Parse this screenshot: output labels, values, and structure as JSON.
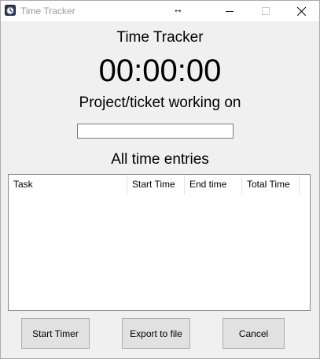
{
  "window": {
    "title": "Time Tracker",
    "icons": {
      "app": "stopwatch-icon",
      "resize": "resize-arrows-icon",
      "minimize": "minimize-icon",
      "maximize": "maximize-icon",
      "close": "close-icon"
    },
    "resize_glyph": "↔"
  },
  "main": {
    "heading": "Time Tracker",
    "clock": "00:00:00",
    "project_label": "Project/ticket working on",
    "project_input_value": "",
    "entries_heading": "All time entries"
  },
  "entries": {
    "columns": [
      "Task",
      "Start Time",
      "End time",
      "Total Time"
    ],
    "rows": []
  },
  "buttons": {
    "start": "Start Timer",
    "export": "Export to file",
    "cancel": "Cancel"
  },
  "colors": {
    "background": "#f0f0f0",
    "titlebar": "#ffffff",
    "title_text": "#9a9a9a",
    "button_face": "#e1e1e1",
    "button_border": "#adadad"
  }
}
